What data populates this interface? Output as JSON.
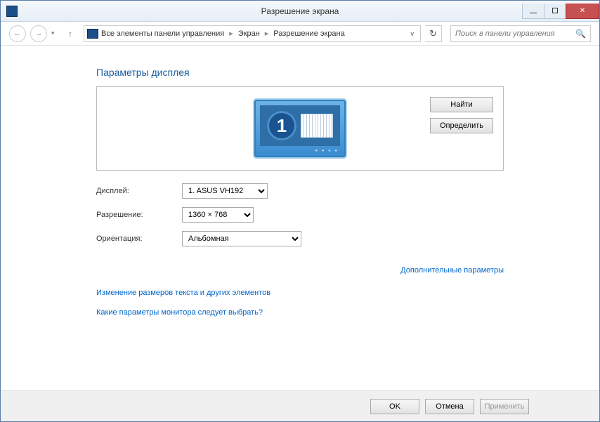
{
  "window": {
    "title": "Разрешение экрана"
  },
  "nav": {
    "breadcrumb": [
      "Все элементы панели управления",
      "Экран",
      "Разрешение экрана"
    ],
    "search_placeholder": "Поиск в панели управления"
  },
  "page": {
    "heading": "Параметры дисплея",
    "monitor_number": "1",
    "buttons": {
      "find": "Найти",
      "identify": "Определить"
    },
    "form": {
      "display_label": "Дисплей:",
      "display_value": "1. ASUS VH192",
      "resolution_label": "Разрешение:",
      "resolution_value": "1360 × 768",
      "orientation_label": "Ориентация:",
      "orientation_value": "Альбомная"
    },
    "links": {
      "advanced": "Дополнительные параметры",
      "text_size": "Изменение размеров текста и других элементов",
      "help": "Какие параметры монитора следует выбрать?"
    }
  },
  "footer": {
    "ok": "OK",
    "cancel": "Отмена",
    "apply": "Применить"
  }
}
